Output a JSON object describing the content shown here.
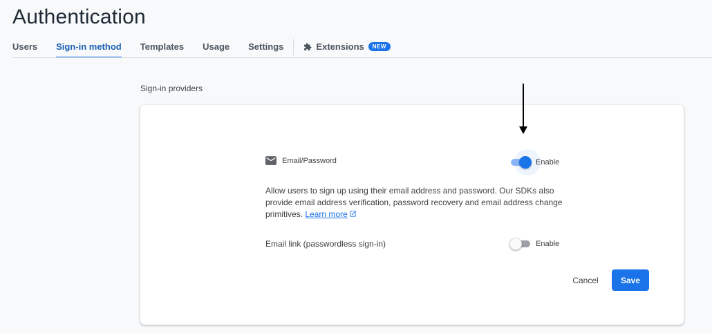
{
  "page": {
    "title": "Authentication"
  },
  "tabs": [
    {
      "label": "Users"
    },
    {
      "label": "Sign-in method",
      "active": true
    },
    {
      "label": "Templates"
    },
    {
      "label": "Usage"
    },
    {
      "label": "Settings"
    }
  ],
  "extensions_tab": {
    "label": "Extensions",
    "badge": "NEW",
    "icon": "puzzle-piece-icon"
  },
  "section": {
    "label": "Sign-in providers"
  },
  "email_password": {
    "icon": "mail-icon",
    "name": "Email/Password",
    "enabled": true,
    "toggle_label": "Enable",
    "description": "Allow users to sign up using their email address and password. Our SDKs also provide email address verification, password recovery and email address change primitives.",
    "learn_more": "Learn more"
  },
  "email_link": {
    "name": "Email link (passwordless sign-in)",
    "enabled": false,
    "toggle_label": "Enable"
  },
  "actions": {
    "cancel": "Cancel",
    "save": "Save"
  },
  "colors": {
    "accent": "#1a73e8",
    "active_tab": "#1a5fb4",
    "toggle_on_track": "#8ab4f8"
  }
}
